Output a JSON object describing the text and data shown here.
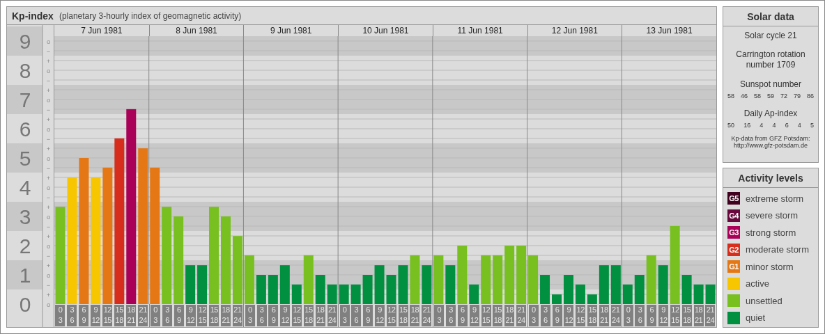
{
  "title": {
    "name": "Kp-index",
    "description": "(planetary 3-hourly index of geomagnetic activity)"
  },
  "chart": {
    "days": [
      {
        "date": "7 Jun 1981",
        "slots": [
          {
            "from": "0",
            "to": "3"
          },
          {
            "from": "3",
            "to": "6"
          },
          {
            "from": "6",
            "to": "9"
          },
          {
            "from": "9",
            "to": "12"
          },
          {
            "from": "12",
            "to": "15"
          },
          {
            "from": "15",
            "to": "18"
          },
          {
            "from": "18",
            "to": "21"
          },
          {
            "from": "21",
            "to": "24"
          }
        ]
      },
      {
        "date": "8 Jun 1981",
        "slots": [
          {
            "from": "0",
            "to": "3"
          },
          {
            "from": "3",
            "to": "6"
          },
          {
            "from": "6",
            "to": "9"
          },
          {
            "from": "9",
            "to": "12"
          },
          {
            "from": "12",
            "to": "15"
          },
          {
            "from": "15",
            "to": "18"
          },
          {
            "from": "18",
            "to": "21"
          },
          {
            "from": "21",
            "to": "24"
          }
        ]
      },
      {
        "date": "9 Jun 1981",
        "slots": [
          {
            "from": "0",
            "to": "3"
          },
          {
            "from": "3",
            "to": "6"
          },
          {
            "from": "6",
            "to": "9"
          },
          {
            "from": "9",
            "to": "12"
          },
          {
            "from": "12",
            "to": "15"
          },
          {
            "from": "15",
            "to": "18"
          },
          {
            "from": "18",
            "to": "21"
          },
          {
            "from": "21",
            "to": "24"
          }
        ]
      },
      {
        "date": "10 Jun 1981",
        "slots": [
          {
            "from": "0",
            "to": "3"
          },
          {
            "from": "3",
            "to": "6"
          },
          {
            "from": "6",
            "to": "9"
          },
          {
            "from": "9",
            "to": "12"
          },
          {
            "from": "12",
            "to": "15"
          },
          {
            "from": "15",
            "to": "18"
          },
          {
            "from": "18",
            "to": "21"
          },
          {
            "from": "21",
            "to": "24"
          }
        ]
      },
      {
        "date": "11 Jun 1981",
        "slots": [
          {
            "from": "0",
            "to": "3"
          },
          {
            "from": "3",
            "to": "6"
          },
          {
            "from": "6",
            "to": "9"
          },
          {
            "from": "9",
            "to": "12"
          },
          {
            "from": "12",
            "to": "15"
          },
          {
            "from": "15",
            "to": "18"
          },
          {
            "from": "18",
            "to": "21"
          },
          {
            "from": "21",
            "to": "24"
          }
        ]
      },
      {
        "date": "12 Jun 1981",
        "slots": [
          {
            "from": "0",
            "to": "3"
          },
          {
            "from": "3",
            "to": "6"
          },
          {
            "from": "6",
            "to": "9"
          },
          {
            "from": "9",
            "to": "12"
          },
          {
            "from": "12",
            "to": "15"
          },
          {
            "from": "15",
            "to": "18"
          },
          {
            "from": "18",
            "to": "21"
          },
          {
            "from": "21",
            "to": "24"
          }
        ]
      },
      {
        "date": "13 Jun 1981",
        "slots": [
          {
            "from": "0",
            "to": "3"
          },
          {
            "from": "3",
            "to": "6"
          },
          {
            "from": "6",
            "to": "9"
          },
          {
            "from": "9",
            "to": "12"
          },
          {
            "from": "12",
            "to": "15"
          },
          {
            "from": "15",
            "to": "18"
          },
          {
            "from": "18",
            "to": "21"
          },
          {
            "from": "21",
            "to": "24"
          }
        ]
      }
    ],
    "kp_sublevels": [
      "o",
      "−",
      "+",
      "o",
      "−",
      "+",
      "o",
      "−",
      "+",
      "o",
      "−",
      "+",
      "o",
      "−",
      "+",
      "o",
      "−",
      "+",
      "o",
      "−",
      "+",
      "o",
      "−",
      "+",
      "o",
      "−",
      "+",
      "o"
    ],
    "chart_data": {
      "type": "bar",
      "grid": true,
      "ylim": [
        0,
        9
      ],
      "yticks": [
        {
          "value": 9,
          "label": "9"
        },
        {
          "value": 8,
          "label": "8"
        },
        {
          "value": 7,
          "label": "7"
        },
        {
          "value": 6,
          "label": "6"
        },
        {
          "value": 5,
          "label": "5"
        },
        {
          "value": 4,
          "label": "4"
        },
        {
          "value": 3,
          "label": "3"
        },
        {
          "value": 2,
          "label": "2"
        },
        {
          "value": 1,
          "label": "1"
        },
        {
          "value": 0,
          "label": "0"
        }
      ],
      "values": [
        3.33,
        4.33,
        5,
        4.33,
        4.67,
        5.67,
        6.67,
        5.33,
        4.67,
        3.33,
        3,
        1.33,
        1.33,
        3.33,
        3,
        2.33,
        1.67,
        1,
        1,
        1.33,
        0.67,
        1.67,
        1,
        0.67,
        0.67,
        0.67,
        1,
        1.33,
        1,
        1.33,
        1.67,
        1.33,
        1.67,
        1.33,
        2,
        0.67,
        1.67,
        1.67,
        2,
        2,
        1.67,
        1,
        0.33,
        1,
        0.67,
        0.33,
        1.33,
        1.33,
        0.67,
        1,
        1.67,
        1.33,
        2.67,
        1,
        0.67,
        0.67
      ]
    }
  },
  "solar_data": {
    "title": "Solar data",
    "cycle": "Solar cycle 21",
    "carrington": "Carrington rotation number 1709",
    "sunspot_label": "Sunspot number",
    "sunspot_numbers": [
      "58",
      "46",
      "58",
      "59",
      "72",
      "79",
      "86"
    ],
    "ap_label": "Daily Ap-index",
    "ap_values": [
      "50",
      "16",
      "4",
      "4",
      "6",
      "4",
      "5"
    ],
    "source": "Kp-data from GFZ Potsdam:",
    "source_url": "http://www.gfz-potsdam.de"
  },
  "activity_levels": {
    "title": "Activity levels",
    "items": [
      {
        "badge": "G5",
        "label": "extreme storm",
        "color": "#40001e"
      },
      {
        "badge": "G4",
        "label": "severe storm",
        "color": "#68083c"
      },
      {
        "badge": "G3",
        "label": "strong storm",
        "color": "#aa0058"
      },
      {
        "badge": "G2",
        "label": "moderate storm",
        "color": "#d62d1c"
      },
      {
        "badge": "G1",
        "label": "minor storm",
        "color": "#e57815"
      },
      {
        "label": "active",
        "color": "#f8c600"
      },
      {
        "label": "unsettled",
        "color": "#78c020"
      },
      {
        "label": "quiet",
        "color": "#009040"
      }
    ]
  }
}
